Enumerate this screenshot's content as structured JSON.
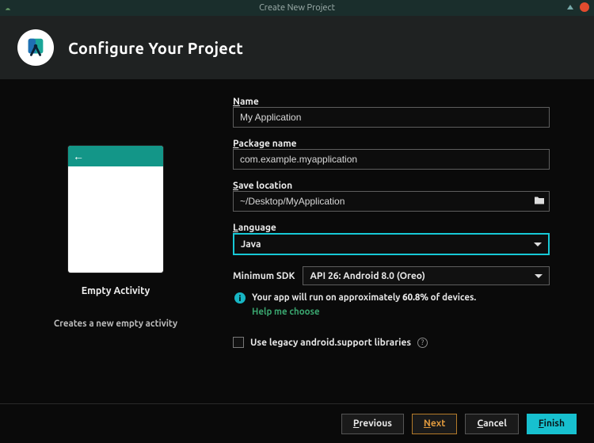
{
  "window": {
    "title": "Create New Project"
  },
  "header": {
    "title": "Configure Your Project"
  },
  "template": {
    "name": "Empty Activity",
    "description": "Creates a new empty activity"
  },
  "form": {
    "name": {
      "label_html": "Name",
      "value": "My Application"
    },
    "package": {
      "label_html": "Package name",
      "value": "com.example.myapplication"
    },
    "save": {
      "label_html": "Save location",
      "value": "~/Desktop/MyApplication"
    },
    "language": {
      "label_html": "Language",
      "selected": "Java"
    },
    "min_sdk": {
      "label": "Minimum SDK",
      "selected": "API 26: Android 8.0 (Oreo)"
    },
    "hint": {
      "prefix": "Your app will run on approximately ",
      "percent": "60.8%",
      "suffix": " of devices.",
      "help": "Help me choose"
    },
    "legacy": {
      "label": "Use legacy android.support libraries"
    }
  },
  "footer": {
    "previous": "Previous",
    "next": "Next",
    "cancel": "Cancel",
    "finish": "Finish"
  }
}
